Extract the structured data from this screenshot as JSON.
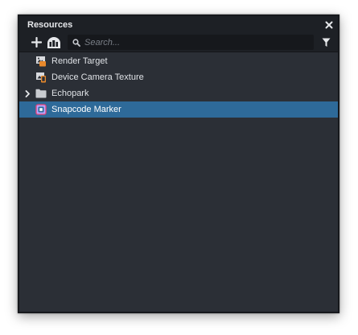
{
  "panel": {
    "title": "Resources"
  },
  "search": {
    "placeholder": "Search...",
    "value": ""
  },
  "items": [
    {
      "label": "Render Target",
      "icon": "render-target-icon",
      "expandable": false,
      "selected": false
    },
    {
      "label": "Device Camera Texture",
      "icon": "device-camera-icon",
      "expandable": false,
      "selected": false
    },
    {
      "label": "Echopark",
      "icon": "folder-icon",
      "expandable": true,
      "selected": false
    },
    {
      "label": "Snapcode Marker",
      "icon": "snapcode-marker-icon",
      "expandable": false,
      "selected": true
    }
  ],
  "colors": {
    "panel_bg": "#2b2f36",
    "toolbar_bg": "#1d2025",
    "selection": "#2e6a99",
    "accent_orange": "#e8892c"
  }
}
